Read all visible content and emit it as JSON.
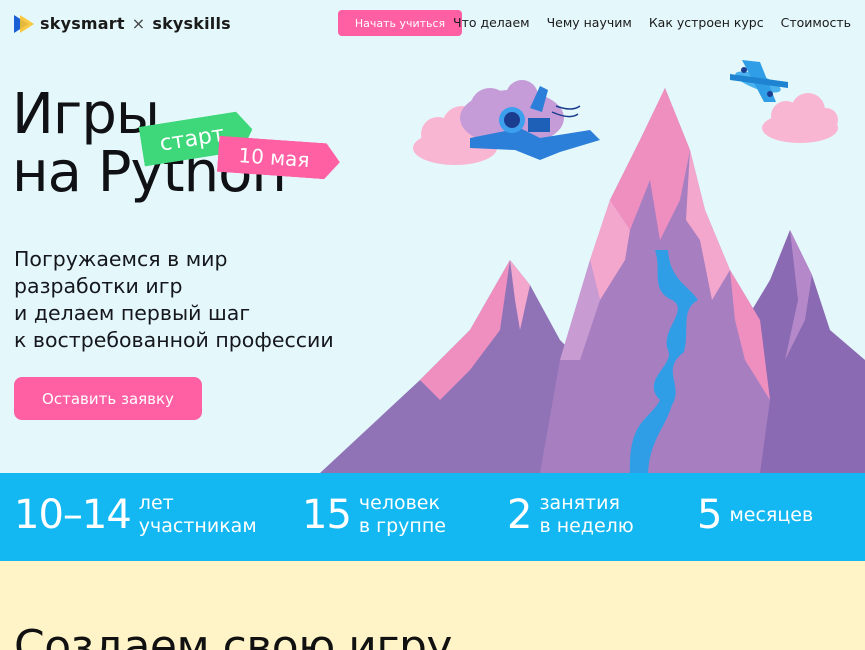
{
  "header": {
    "logo_primary": "skysmart",
    "logo_separator": "×",
    "logo_secondary": "skyskills",
    "cta_label": "Начать учиться",
    "nav": [
      "Что делаем",
      "Чему научим",
      "Как устроен курс",
      "Стоимость"
    ]
  },
  "hero": {
    "title_line1": "Игры",
    "title_line2": "на Python",
    "tag_start": "старт",
    "tag_date": "10 мая",
    "subtitle": [
      "Погружаемся в мир",
      "разработки игр",
      "и делаем первый шаг",
      "к востребованной профессии"
    ],
    "cta_label": "Оставить заявку"
  },
  "stats": [
    {
      "number": "10–14",
      "line1": "лет",
      "line2": "участникам"
    },
    {
      "number": "15",
      "line1": "человек",
      "line2": "в группе"
    },
    {
      "number": "2",
      "line1": "занятия",
      "line2": "в неделю"
    },
    {
      "number": "5",
      "line1": "месяцев",
      "line2": ""
    }
  ],
  "section": {
    "heading": "Создаем свою игру"
  },
  "colors": {
    "hero_bg": "#e4f8fb",
    "accent_pink": "#ff5fa3",
    "accent_green": "#3ed77a",
    "stats_bg": "#13b8f2",
    "lower_bg": "#fff4c8",
    "mountain_purple": "#8f73b6",
    "mountain_pink": "#ef8fc0",
    "river_blue": "#2f9ee6"
  },
  "icons": {
    "logo_mark": "play-triangle-logo-icon",
    "astronaut": "astronaut-illustration",
    "airplane": "airplane-illustration",
    "mountains": "mountain-illustration"
  }
}
